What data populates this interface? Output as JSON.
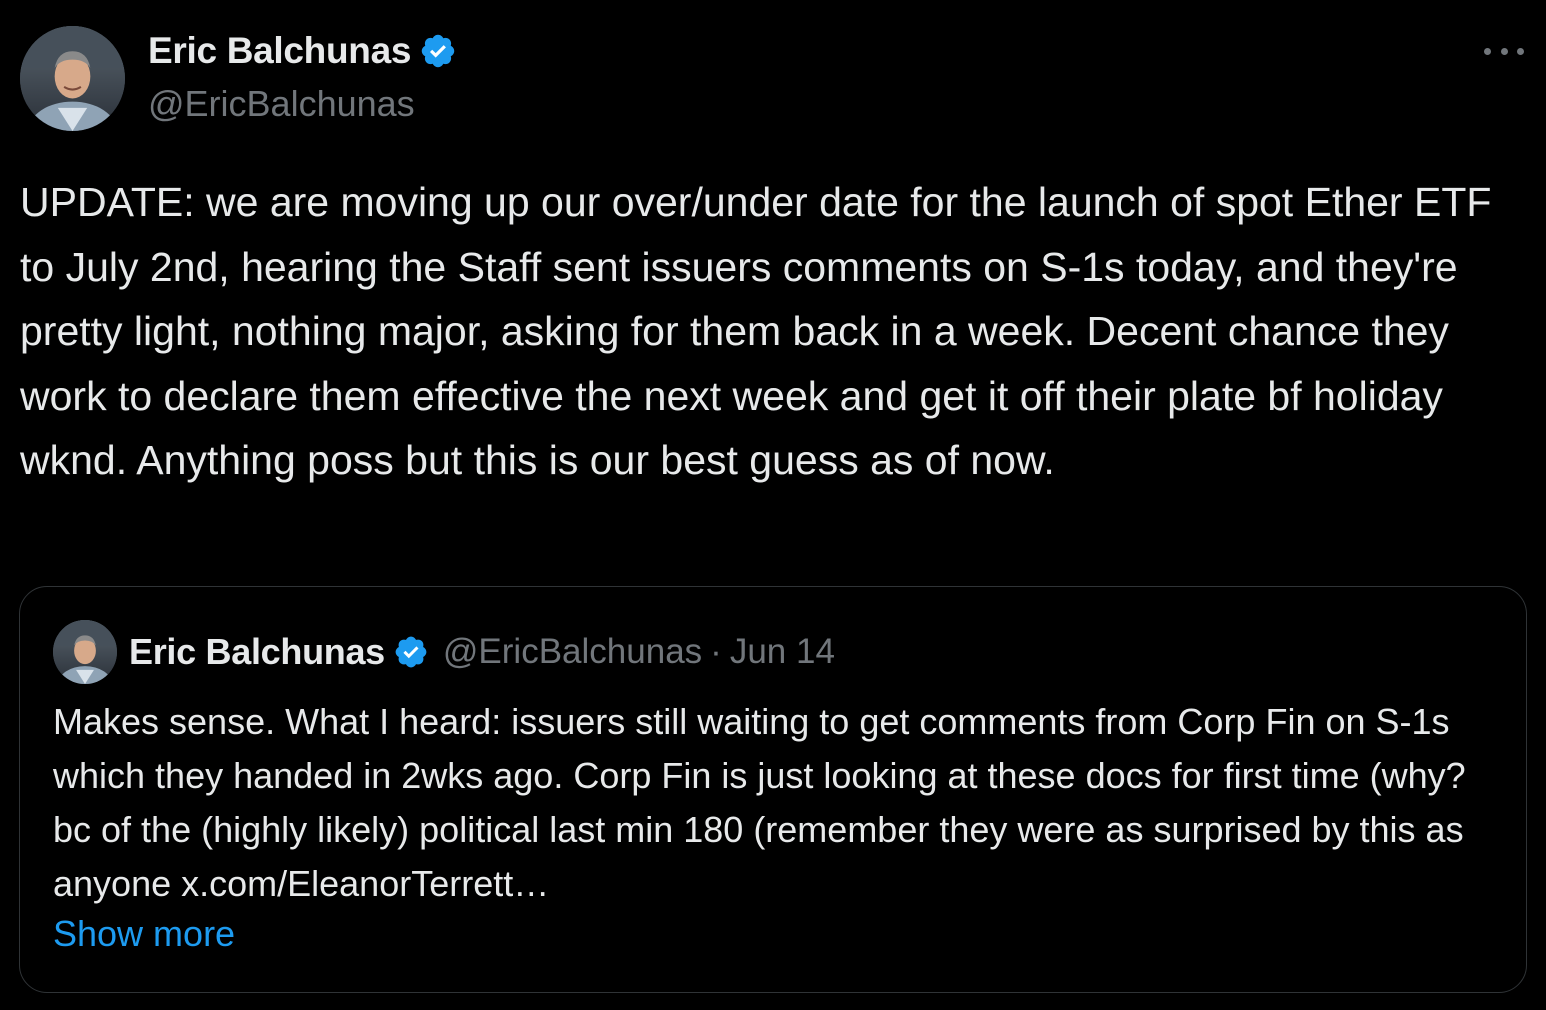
{
  "author": {
    "display_name": "Eric Balchunas",
    "handle": "@EricBalchunas",
    "verified": true
  },
  "tweet": {
    "text": "UPDATE: we are moving up our over/under date for the launch of spot Ether ETF to July 2nd, hearing the Staff sent issuers comments on S-1s today, and they're pretty light, nothing major, asking for them back in a week. Decent chance they work to declare them effective the next week and get it off their plate bf holiday wknd. Anything poss but this is our best guess as of now."
  },
  "quoted_tweet": {
    "display_name": "Eric Balchunas",
    "handle": "@EricBalchunas",
    "separator": "·",
    "date": "Jun 14",
    "text": "Makes sense. What I heard: issuers still waiting to get comments from Corp Fin on S-1s which they handed in 2wks ago. Corp Fin is just looking at these docs for first time (why? bc of the (highly likely) political last min 180 (remember they were as surprised by this as anyone x.com/EleanorTerrett…",
    "show_more_label": "Show more"
  },
  "icons": {
    "verified": "verified-badge-icon",
    "more": "more-options-icon"
  },
  "colors": {
    "background": "#000000",
    "text": "#e7e9ea",
    "secondary": "#71767b",
    "accent": "#1d9bf0",
    "border": "#2f3336"
  }
}
